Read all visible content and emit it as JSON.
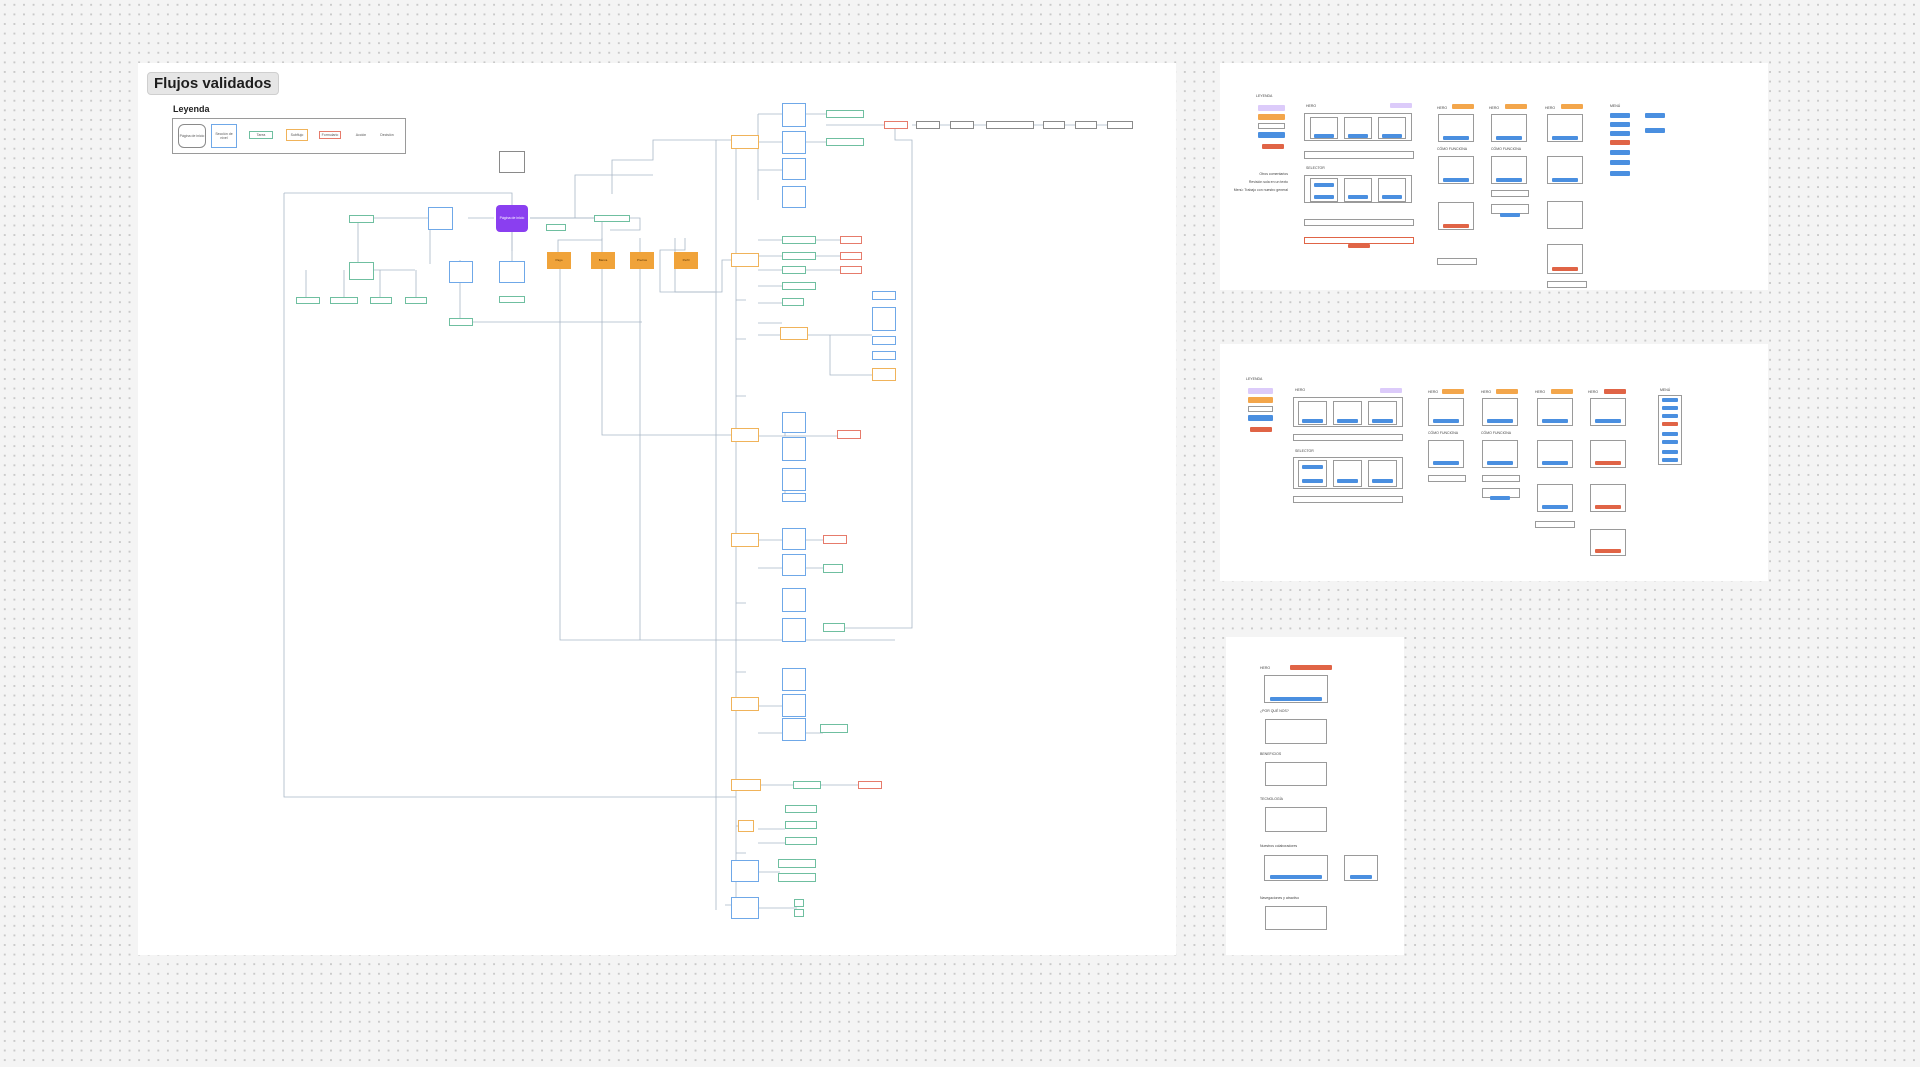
{
  "canvas": {
    "title": "Flujos validados"
  },
  "legend": {
    "title": "Leyenda",
    "items": [
      {
        "label": "Página de inicio",
        "color": "#8a8a8a"
      },
      {
        "label": "Sección de nivel",
        "color": "#6fa8e8"
      },
      {
        "label": "Tarea",
        "color": "#6fa8e8"
      },
      {
        "label": "Subflujo",
        "color": "#f0b35a"
      },
      {
        "label": "Formulario",
        "color": "#e67b6b"
      },
      {
        "label": "Acción",
        "color": "#555555"
      },
      {
        "label": "Decisión",
        "color": "#555555"
      }
    ]
  },
  "flow": {
    "home_label": "Página de inicio",
    "accent_home": "#8a3ff0",
    "accent_process": "#f0a33a",
    "process_labels": [
      "Pago",
      "Banca",
      "Precios",
      "Perfil"
    ]
  },
  "wireframes": {
    "legend_label": "LEYENDA",
    "hero_label": "HERO",
    "selector_label": "SELECTOR",
    "como_funciona": "CÓMO FUNCIONA",
    "annotations": [
      "Otros comentarios",
      "Revisión sola en un texto",
      "Menú: Trabajo con nuestro general"
    ],
    "panel3_sections": [
      "HERO",
      "¿POR QUÉ NOS?",
      "BENEFICIOS",
      "TECNOLOGÍA",
      "Nuestros colaboradores",
      "Navegaciones y atractivo"
    ]
  },
  "colors": {
    "board": "#ffffff",
    "canvas": "#f4f4f4",
    "blue_button": "#4a8fe0",
    "orange_tag": "#f3a64b",
    "red_tag": "#e06446",
    "lilac_tag": "#dccbfa"
  }
}
